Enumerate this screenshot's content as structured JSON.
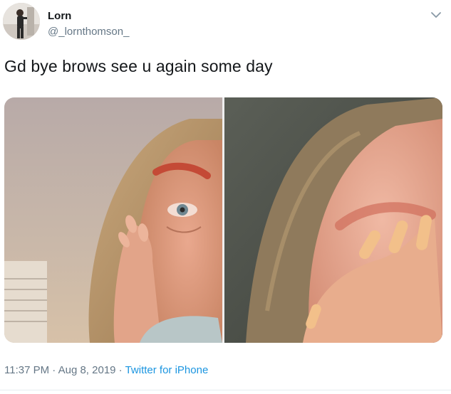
{
  "user": {
    "display_name": "Lorn",
    "handle": "@_lornthomson_"
  },
  "tweet": {
    "text": "Gd bye brows see u again some day",
    "time": "11:37 PM",
    "date": "Aug 8, 2019",
    "separator": " · ",
    "source": "Twitter for iPhone"
  },
  "icons": {
    "menu": "chevron-down-icon"
  },
  "colors": {
    "link": "#1b95e0",
    "muted": "#657786"
  }
}
